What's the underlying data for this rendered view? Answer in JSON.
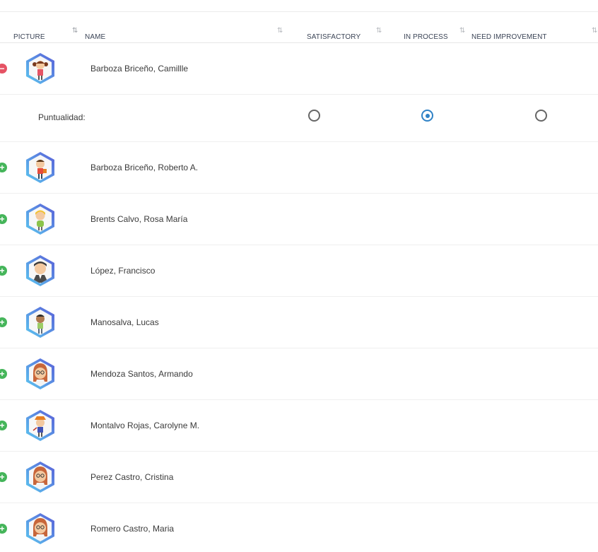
{
  "table": {
    "columns": {
      "picture": "PICTURE",
      "name": "NAME",
      "satisfactory": "SATISFACTORY",
      "in_process": "IN PROCESS",
      "need_improvement": "NEED IMPROVEMENT"
    },
    "sort_icon_glyph": "⇅",
    "expanded_detail": {
      "label": "Puntualidad:",
      "selected_option": "in_process"
    },
    "students": [
      {
        "name": "Barboza Briceño, Camillle",
        "expanded": true,
        "avatar": "girl-pigtails"
      },
      {
        "name": "Barboza Briceño, Roberto A.",
        "expanded": false,
        "avatar": "boy-backpack"
      },
      {
        "name": "Brents Calvo, Rosa María",
        "expanded": false,
        "avatar": "girl-blonde"
      },
      {
        "name": "López, Francisco",
        "expanded": false,
        "avatar": "man-suit"
      },
      {
        "name": "Manosalva, Lucas",
        "expanded": false,
        "avatar": "boy-dark-hair"
      },
      {
        "name": "Mendoza Santos, Armando",
        "expanded": false,
        "avatar": "woman-glasses"
      },
      {
        "name": "Montalvo Rojas, Carolyne M.",
        "expanded": false,
        "avatar": "girl-hat"
      },
      {
        "name": "Perez Castro, Cristina",
        "expanded": false,
        "avatar": "woman-glasses"
      },
      {
        "name": "Romero Castro, Maria",
        "expanded": false,
        "avatar": "woman-glasses"
      }
    ]
  },
  "colors": {
    "expand_plus": "#45b55a",
    "collapse_minus": "#e55364",
    "radio_selected": "#2f82c6",
    "avatar_frame_light": "#5bc8f0",
    "avatar_frame_dark": "#5a5fd8"
  }
}
